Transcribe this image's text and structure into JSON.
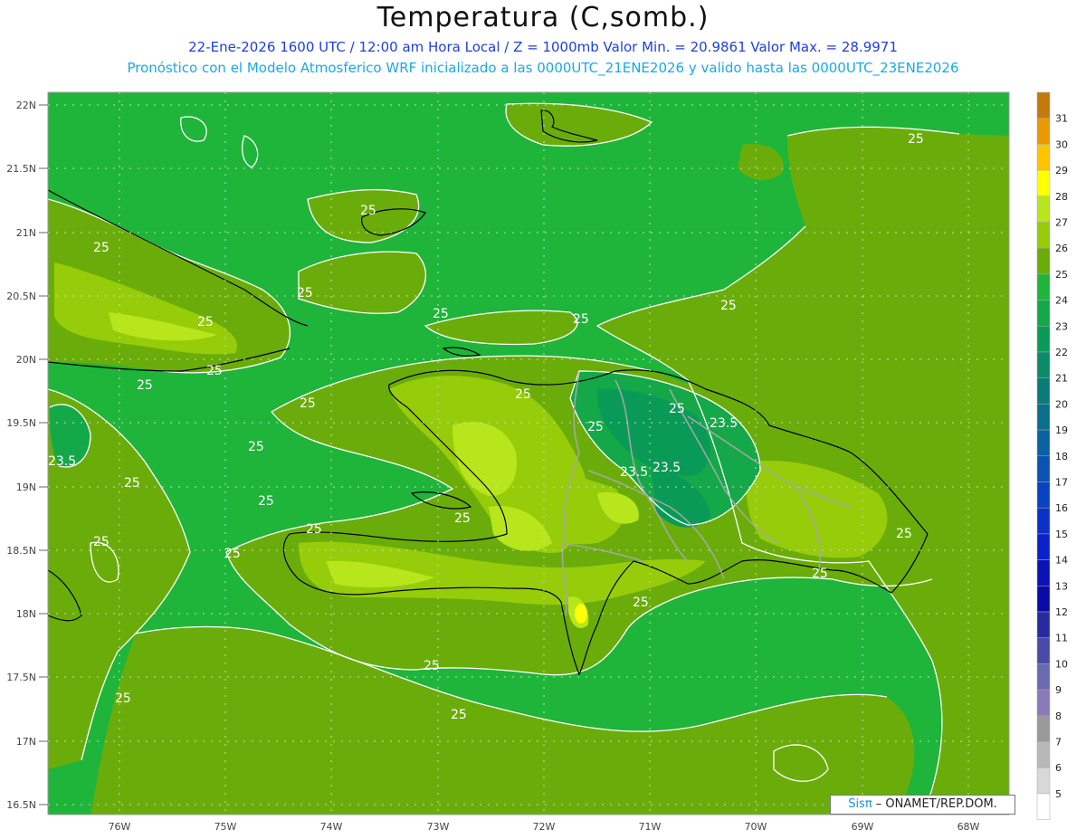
{
  "header": {
    "title": "Temperatura (C,somb.)",
    "line1": "22-Ene-2026 1600 UTC / 12:00 am Hora Local / Z = 1000mb   Valor Min. = 20.9861   Valor Max. = 28.9971",
    "line2": "Pronóstico con el Modelo Atmosferico WRF inicializado a las 0000UTC_21ENE2026 y valido hasta las  0000UTC_23ENE2026"
  },
  "map": {
    "lat_labels": [
      "22N",
      "21.5N",
      "21N",
      "20.5N",
      "20N",
      "19.5N",
      "19N",
      "18.5N",
      "18N",
      "17.5N",
      "17N",
      "16.5N"
    ],
    "lon_labels": [
      "76W",
      "75W",
      "74W",
      "73W",
      "72W",
      "71W",
      "70W",
      "69W",
      "68W"
    ],
    "contour_labels": [
      "25",
      "25",
      "25",
      "25",
      "25",
      "25",
      "25",
      "25",
      "25",
      "25",
      "25",
      "25",
      "25",
      "25",
      "25",
      "25",
      "25",
      "25",
      "25",
      "25",
      "25",
      "25",
      "25",
      "25",
      "25",
      "25",
      "25",
      "23.5",
      "23.5",
      "23.5",
      "23.5"
    ],
    "colors": {
      "t22": "#0a9a58",
      "t23": "#14a848",
      "t24": "#1eb53a",
      "t25": "#6aad0a",
      "t26": "#96cc0a",
      "t27": "#b8e61c"
    }
  },
  "colorbar": {
    "labels": [
      "31",
      "30",
      "29",
      "28",
      "27",
      "26",
      "25",
      "24",
      "23",
      "22",
      "21",
      "20",
      "19",
      "18",
      "17",
      "16",
      "15",
      "14",
      "13",
      "12",
      "11",
      "10",
      "9",
      "8",
      "7",
      "6",
      "5"
    ],
    "colors": [
      "#c47a0a",
      "#e89a00",
      "#ffc400",
      "#ffff00",
      "#b8e61c",
      "#96cc0a",
      "#6aad0a",
      "#1eb53a",
      "#14a848",
      "#0a9a58",
      "#0a8c68",
      "#0a7c78",
      "#0a6f8c",
      "#0a62a0",
      "#0a52b4",
      "#0a42c0",
      "#0a32c8",
      "#0a22c8",
      "#0a12b8",
      "#0a0aa8",
      "#2a2aa0",
      "#4a4aa8",
      "#6a6ab0",
      "#8a7ab8",
      "#9a9a9a",
      "#b8b8b8",
      "#d8d8d8",
      "#ffffff"
    ]
  },
  "footer": {
    "sis": "Sisπ",
    "agency": " – ONAMET/REP.DOM."
  }
}
